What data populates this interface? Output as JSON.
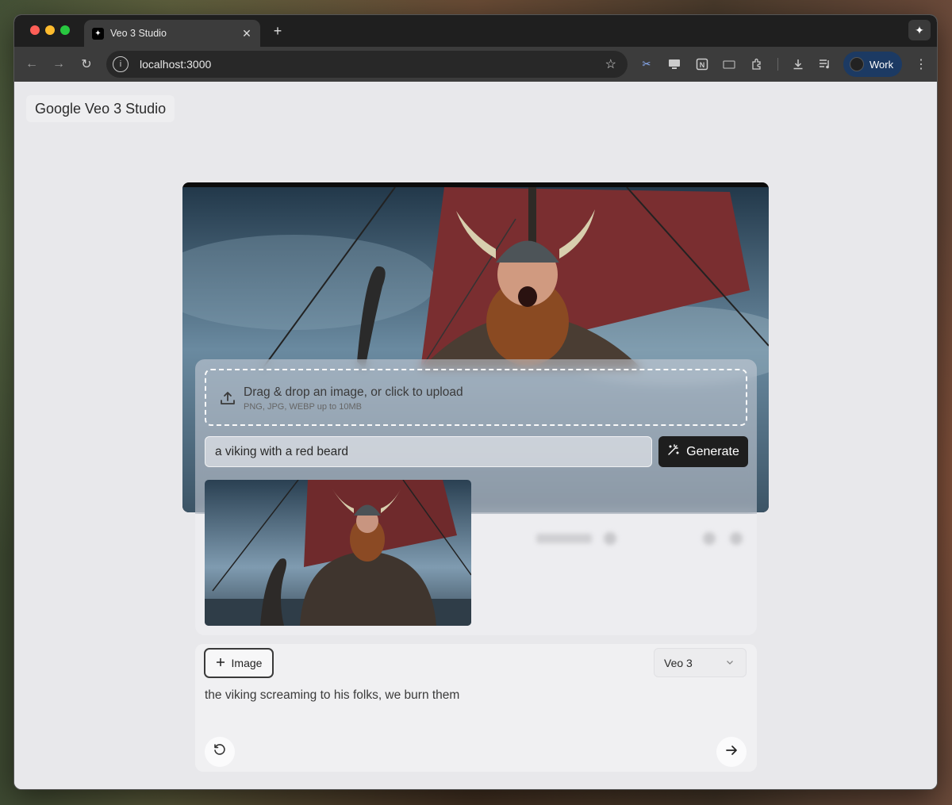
{
  "browser": {
    "tab_title": "Veo 3 Studio",
    "url": "localhost:3000",
    "profile_label": "Work",
    "icons": [
      "back-icon",
      "forward-icon",
      "reload-icon",
      "site-info-icon",
      "bookmark-star-icon",
      "scissors-extension-icon",
      "cast-icon",
      "notion-icon",
      "tablet-icon",
      "extensions-icon",
      "download-icon",
      "playlist-icon",
      "menu-icon",
      "gemini-icon"
    ]
  },
  "app": {
    "title": "Google Veo 3 Studio"
  },
  "upload": {
    "title": "Drag & drop an image, or click to upload",
    "subtitle": "PNG, JPG, WEBP up to 10MB"
  },
  "prompt": {
    "value": "a viking with a red beard"
  },
  "generate": {
    "label": "Generate"
  },
  "composer": {
    "image_button_label": "Image",
    "model_value": "Veo 3",
    "text": "the viking screaming to his folks, we burn them"
  },
  "colors": {
    "accent_dark": "#1e1e1e",
    "page_bg": "#e8e8eb",
    "profile_chip": "#1c3a63"
  }
}
